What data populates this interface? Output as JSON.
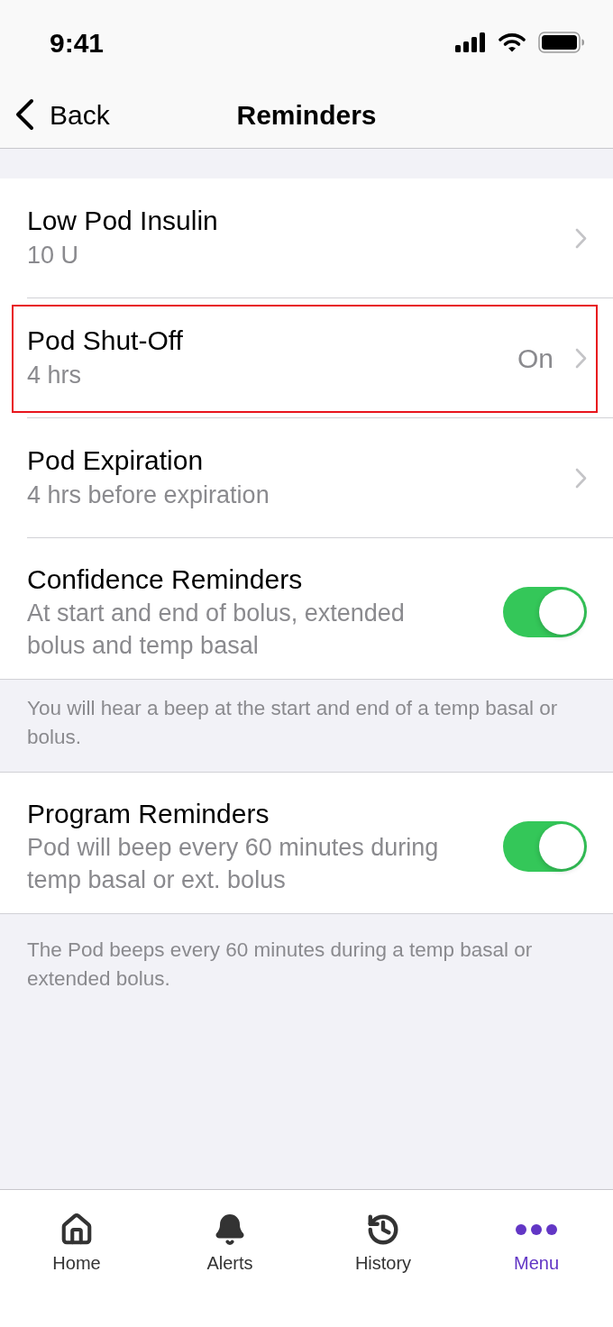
{
  "status_bar": {
    "time": "9:41"
  },
  "nav_bar": {
    "back": "Back",
    "title": "Reminders"
  },
  "groups": [
    {
      "rows": [
        {
          "kind": "link",
          "title": "Low Pod Insulin",
          "subtitle": "10 U",
          "highlighted": false
        },
        {
          "kind": "link",
          "title": "Pod Shut-Off",
          "subtitle": "4 hrs",
          "value": "On",
          "highlighted": true
        },
        {
          "kind": "link",
          "title": "Pod Expiration",
          "subtitle": "4 hrs before expiration",
          "highlighted": false
        },
        {
          "kind": "toggle",
          "title": "Confidence Reminders",
          "subtitle": "At start and end of bolus, extended bolus and temp basal",
          "on": true,
          "highlighted": false
        }
      ],
      "footer": "You will hear a beep at the start and end of a temp basal or bolus."
    },
    {
      "rows": [
        {
          "kind": "toggle",
          "title": "Program Reminders",
          "subtitle": "Pod will beep every 60 minutes during temp basal or ext. bolus",
          "on": true,
          "highlighted": false
        }
      ],
      "footer": "The Pod beeps every 60 minutes during a temp basal or extended bolus."
    }
  ],
  "tab_bar": [
    {
      "label": "Home",
      "selected": false
    },
    {
      "label": "Alerts",
      "selected": false
    },
    {
      "label": "History",
      "selected": false
    },
    {
      "label": "Menu",
      "selected": true
    }
  ]
}
